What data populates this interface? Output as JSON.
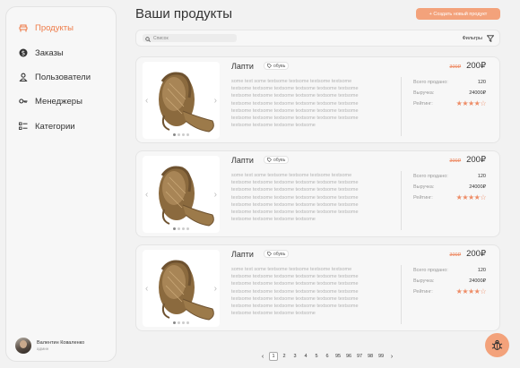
{
  "sidebar": {
    "items": [
      {
        "label": "Продукты",
        "icon": "chair-icon",
        "active": true
      },
      {
        "label": "Заказы",
        "icon": "dollar-icon",
        "active": false
      },
      {
        "label": "Пользователи",
        "icon": "user-icon",
        "active": false
      },
      {
        "label": "Менеджеры",
        "icon": "key-icon",
        "active": false
      },
      {
        "label": "Категории",
        "icon": "list-icon",
        "active": false
      }
    ],
    "user": {
      "name": "Валентин Коваленко",
      "role": "админ"
    }
  },
  "header": {
    "title": "Ваши продукты",
    "create_button": "+ Создать новый продукт"
  },
  "search": {
    "placeholder": "Список",
    "filters_label": "Фильтры"
  },
  "products": [
    {
      "name": "Лапти",
      "tag": "обувь",
      "description": "some text some textsome textsome textsome textsome textsome textsome textsome textsome textsome textsome textsome textsome textsome textsome textsome textsome textsome textsome textsome textsome textsome textsome textsome textsome textsome textsome textsome textsome textsome textsome textsome textsome textsome textsome textsome textsome textsome textsome",
      "old_price": "300₽",
      "new_price": "200₽",
      "sold_label": "Всего продано:",
      "sold": "120",
      "revenue_label": "Выручка:",
      "revenue": "24000₽",
      "rating_label": "Рейтинг:",
      "rating": 4
    },
    {
      "name": "Лапти",
      "tag": "обувь",
      "description": "some text some textsome textsome textsome textsome textsome textsome textsome textsome textsome textsome textsome textsome textsome textsome textsome textsome textsome textsome textsome textsome textsome textsome textsome textsome textsome textsome textsome textsome textsome textsome textsome textsome textsome textsome textsome textsome textsome textsome",
      "old_price": "300₽",
      "new_price": "200₽",
      "sold_label": "Всего продано:",
      "sold": "120",
      "revenue_label": "Выручка:",
      "revenue": "24000₽",
      "rating_label": "Рейтинг:",
      "rating": 4
    },
    {
      "name": "Лапти",
      "tag": "обувь",
      "description": "some text some textsome textsome textsome textsome textsome textsome textsome textsome textsome textsome textsome textsome textsome textsome textsome textsome textsome textsome textsome textsome textsome textsome textsome textsome textsome textsome textsome textsome textsome textsome textsome textsome textsome textsome textsome textsome textsome textsome",
      "old_price": "300₽",
      "new_price": "200₽",
      "sold_label": "Всего продано:",
      "sold": "120",
      "revenue_label": "Выручка:",
      "revenue": "24000₽",
      "rating_label": "Рейтинг:",
      "rating": 4
    }
  ],
  "pagination": {
    "pages": [
      "1",
      "2",
      "3",
      "4",
      "5",
      "6",
      "95",
      "96",
      "97",
      "98",
      "99"
    ],
    "current": "1"
  },
  "colors": {
    "accent": "#ee7b48",
    "button": "#f3a27b",
    "star": "#ee8c66"
  }
}
